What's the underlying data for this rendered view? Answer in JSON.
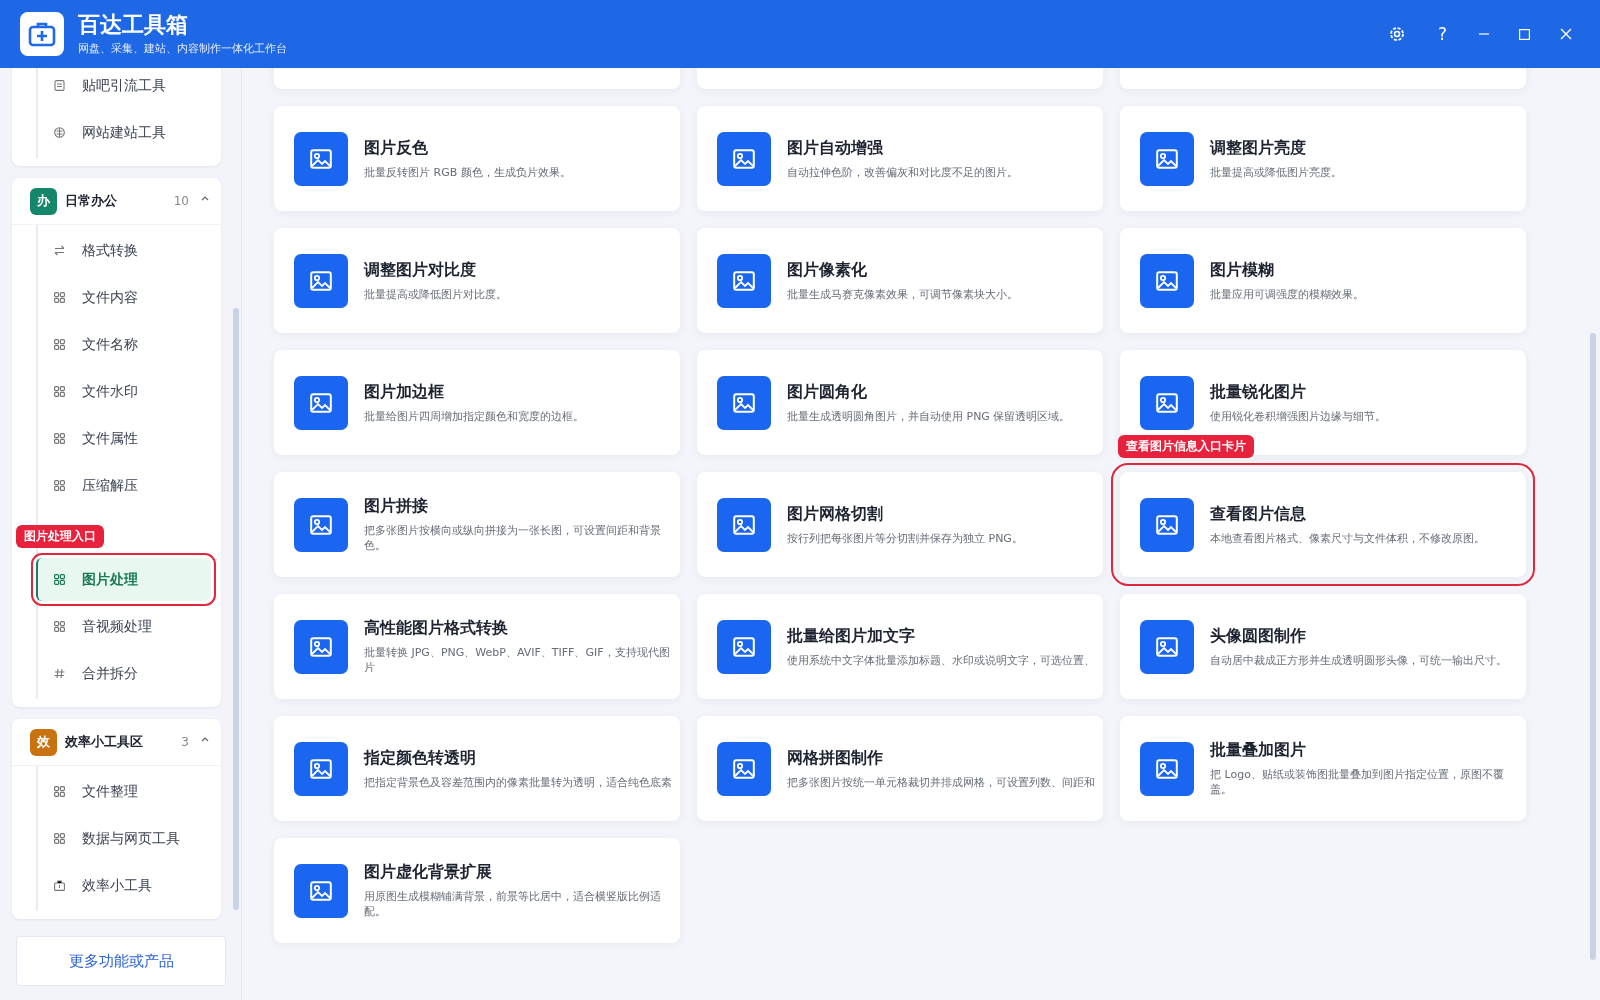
{
  "app": {
    "title": "百达工具箱",
    "subtitle": "网盘、采集、建站、内容制作一体化工作台",
    "help_label": "?"
  },
  "sidebar": {
    "groups": [
      {
        "items": [
          {
            "label": "贴吧引流工具",
            "kind": "document",
            "selected": false
          },
          {
            "label": "网站建站工具",
            "kind": "globe",
            "selected": false
          }
        ]
      },
      {
        "name": "日常办公",
        "badge": "办",
        "color": "#16866a",
        "count": "10",
        "expanded": true,
        "items": [
          {
            "label": "格式转换",
            "kind": "swap",
            "selected": false
          },
          {
            "label": "文件内容",
            "kind": "grid",
            "selected": false
          },
          {
            "label": "文件名称",
            "kind": "grid",
            "selected": false
          },
          {
            "label": "文件水印",
            "kind": "grid",
            "selected": false
          },
          {
            "label": "文件属性",
            "kind": "grid",
            "selected": false
          },
          {
            "label": "压缩解压",
            "kind": "grid",
            "selected": false
          },
          {
            "label": "图片处理",
            "kind": "grid",
            "selected": true,
            "callout": "图片处理入口"
          },
          {
            "label": "音视频处理",
            "kind": "grid",
            "selected": false
          },
          {
            "label": "合并拆分",
            "kind": "hash",
            "selected": false
          }
        ]
      },
      {
        "name": "效率小工具区",
        "badge": "效",
        "color": "#c8730f",
        "count": "3",
        "expanded": true,
        "items": [
          {
            "label": "文件整理",
            "kind": "grid",
            "selected": false
          },
          {
            "label": "数据与网页工具",
            "kind": "grid",
            "selected": false
          },
          {
            "label": "效率小工具",
            "kind": "toolbox",
            "selected": false
          }
        ]
      }
    ],
    "more_button": "更多功能或产品"
  },
  "cards": [
    {
      "title": "图片反色",
      "desc": "批量反转图片 RGB 颜色，生成负片效果。"
    },
    {
      "title": "图片自动增强",
      "desc": "自动拉伸色阶，改善偏灰和对比度不足的图片。"
    },
    {
      "title": "调整图片亮度",
      "desc": "批量提高或降低图片亮度。"
    },
    {
      "title": "调整图片对比度",
      "desc": "批量提高或降低图片对比度。"
    },
    {
      "title": "图片像素化",
      "desc": "批量生成马赛克像素效果，可调节像素块大小。"
    },
    {
      "title": "图片模糊",
      "desc": "批量应用可调强度的模糊效果。"
    },
    {
      "title": "图片加边框",
      "desc": "批量给图片四周增加指定颜色和宽度的边框。"
    },
    {
      "title": "图片圆角化",
      "desc": "批量生成透明圆角图片，并自动使用 PNG 保留透明区域。"
    },
    {
      "title": "批量锐化图片",
      "desc": "使用锐化卷积增强图片边缘与细节。"
    },
    {
      "title": "图片拼接",
      "desc": "把多张图片按横向或纵向拼接为一张长图，可设置间距和背景色。"
    },
    {
      "title": "图片网格切割",
      "desc": "按行列把每张图片等分切割并保存为独立 PNG。"
    },
    {
      "title": "查看图片信息",
      "desc": "本地查看图片格式、像素尺寸与文件体积，不修改原图。",
      "callout": "查看图片信息入口卡片"
    },
    {
      "title": "高性能图片格式转换",
      "desc": "批量转换 JPG、PNG、WebP、AVIF、TIFF、GIF，支持现代图片"
    },
    {
      "title": "批量给图片加文字",
      "desc": "使用系统中文字体批量添加标题、水印或说明文字，可选位置、"
    },
    {
      "title": "头像圆图制作",
      "desc": "自动居中裁成正方形并生成透明圆形头像，可统一输出尺寸。"
    },
    {
      "title": "指定颜色转透明",
      "desc": "把指定背景色及容差范围内的像素批量转为透明，适合纯色底素"
    },
    {
      "title": "网格拼图制作",
      "desc": "把多张图片按统一单元格裁切并排成网格，可设置列数、间距和"
    },
    {
      "title": "批量叠加图片",
      "desc": "把 Logo、贴纸或装饰图批量叠加到图片指定位置，原图不覆盖。"
    },
    {
      "title": "图片虚化背景扩展",
      "desc": "用原图生成模糊铺满背景，前景等比居中，适合横竖版比例适配。"
    }
  ]
}
